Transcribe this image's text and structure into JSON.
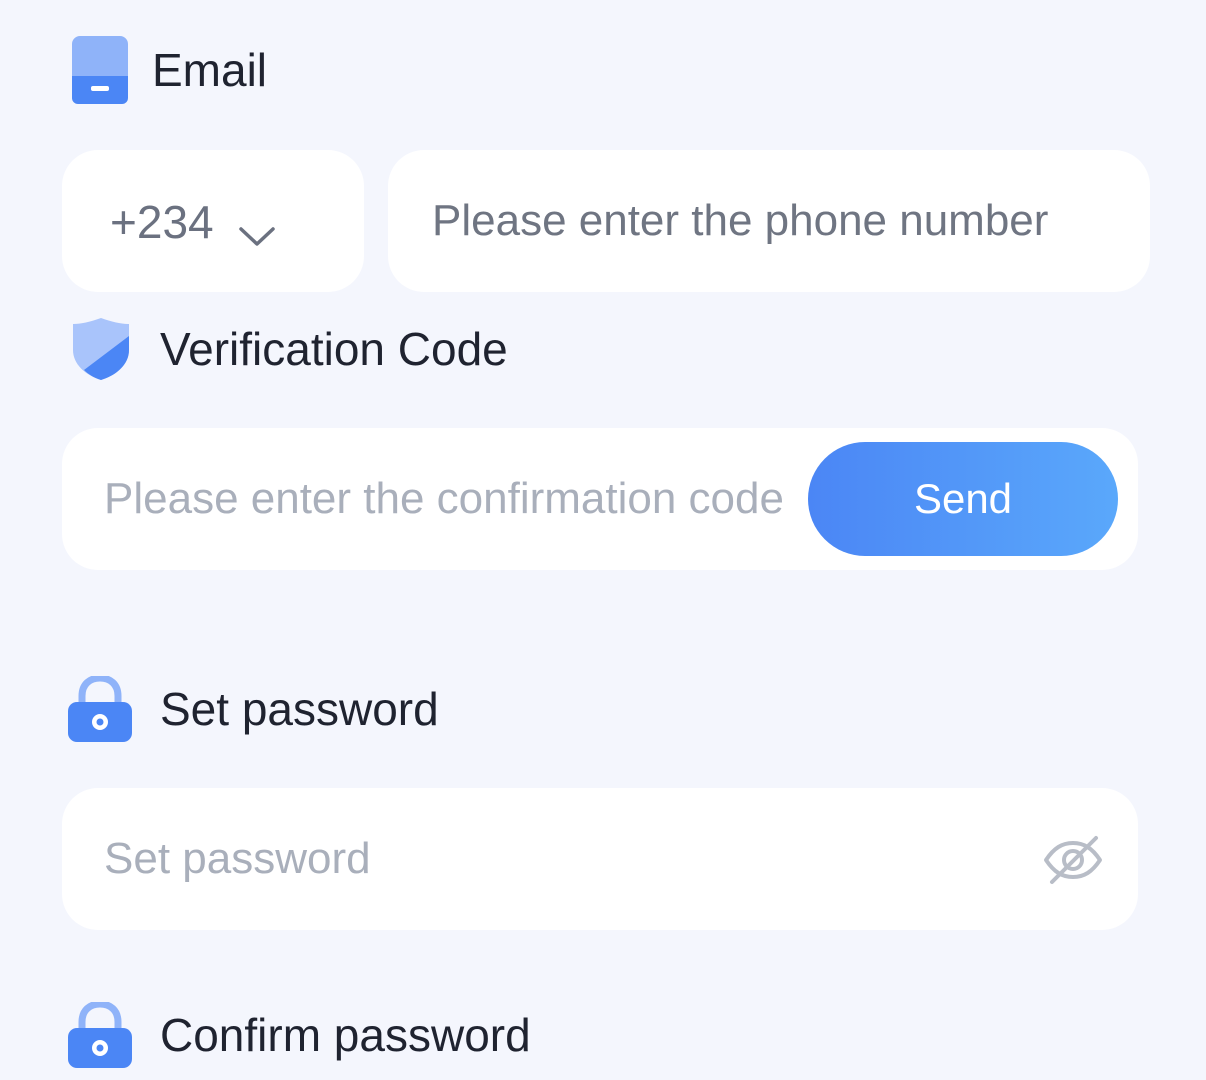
{
  "email_section": {
    "title": "Email",
    "icon": "inbox-icon"
  },
  "phone": {
    "country_code": "+234",
    "chevron_icon": "chevron-down-icon",
    "placeholder": "Please enter the phone number"
  },
  "verification_section": {
    "title": "Verification Code",
    "icon": "shield-icon"
  },
  "verification": {
    "placeholder": "Please enter the confirmation code",
    "send_label": "Send"
  },
  "password_section": {
    "title": "Set password",
    "icon": "lock-icon"
  },
  "password": {
    "placeholder": "Set password",
    "visibility_icon": "eye-off-icon"
  },
  "confirm_section": {
    "title": "Confirm password",
    "icon": "lock-icon"
  },
  "colors": {
    "background": "#f4f6fd",
    "accent_blue": "#4b86f5",
    "accent_light_blue": "#5aa8fb",
    "card": "#ffffff",
    "title_text": "#1f2330",
    "placeholder_text": "#a9afbb"
  }
}
